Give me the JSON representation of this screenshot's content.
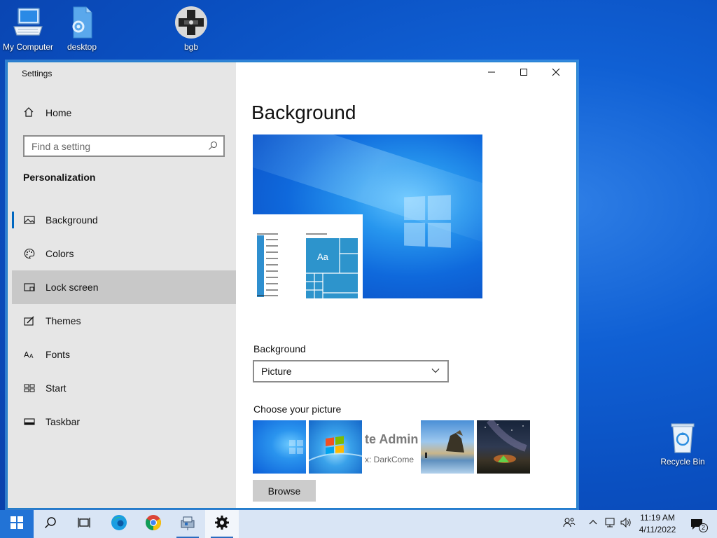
{
  "desktop": {
    "icons": [
      {
        "label": "My Computer",
        "icon": "computer-icon"
      },
      {
        "label": "desktop",
        "icon": "file-icon"
      },
      {
        "label": "bgb",
        "icon": "gamepad-icon"
      },
      {
        "label": "Recycle Bin",
        "icon": "recycle-bin-icon"
      }
    ]
  },
  "window": {
    "title": "Settings",
    "controls": {
      "minimize": "minimize-icon",
      "maximize": "maximize-icon",
      "close": "close-icon"
    }
  },
  "sidebar": {
    "home_label": "Home",
    "search_placeholder": "Find a setting",
    "section_title": "Personalization",
    "items": [
      {
        "label": "Background",
        "icon": "picture-icon",
        "selected": true
      },
      {
        "label": "Colors",
        "icon": "palette-icon"
      },
      {
        "label": "Lock screen",
        "icon": "lock-screen-icon",
        "hover": true
      },
      {
        "label": "Themes",
        "icon": "themes-icon"
      },
      {
        "label": "Fonts",
        "icon": "fonts-icon"
      },
      {
        "label": "Start",
        "icon": "start-icon"
      },
      {
        "label": "Taskbar",
        "icon": "taskbar-icon"
      }
    ]
  },
  "main": {
    "title": "Background",
    "preview": {
      "sample_text": "Aa"
    },
    "background_label": "Background",
    "background_value": "Picture",
    "choose_label": "Choose your picture",
    "thumbnail_text": {
      "line1": "te Admin",
      "line2": "x: DarkCome"
    },
    "browse_label": "Browse"
  },
  "taskbar": {
    "apps": [
      "start-icon",
      "search-icon",
      "task-view-icon",
      "edge-icon",
      "chrome-icon",
      "network-app-icon",
      "settings-icon"
    ],
    "clock": {
      "time": "11:19 AM",
      "date": "4/11/2022"
    },
    "notification_count": "2"
  },
  "colors": {
    "accent": "#0067c0",
    "taskbar": "#d9e5f5",
    "sidebar": "#e6e6e6"
  }
}
